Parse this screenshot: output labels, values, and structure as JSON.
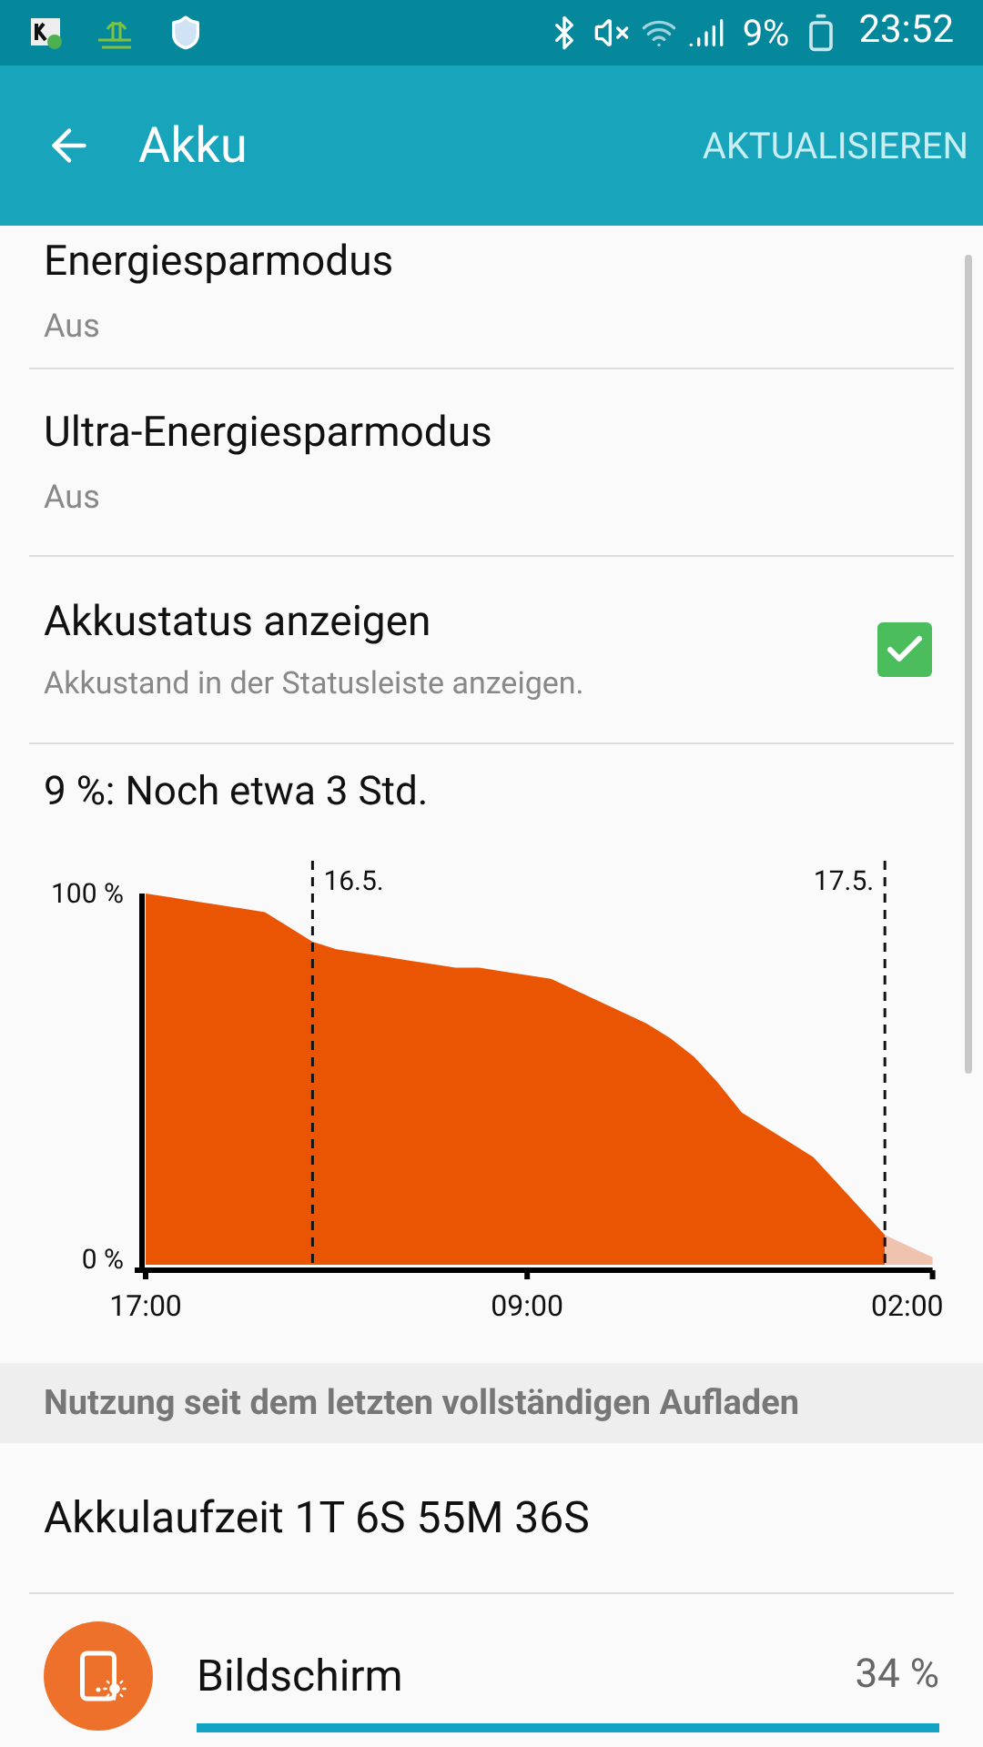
{
  "status_bar": {
    "battery_text": "9%",
    "time": "23:52"
  },
  "app_bar": {
    "title": "Akku",
    "action": "AKTUALISIEREN"
  },
  "settings": [
    {
      "kind": "text",
      "title": "Energiesparmodus",
      "subtitle": "Aus"
    },
    {
      "kind": "text",
      "title": "Ultra-Energiesparmodus",
      "subtitle": "Aus"
    },
    {
      "kind": "checkbox",
      "title": "Akkustatus anzeigen",
      "subtitle": "Akkustand in der Statusleiste anzeigen.",
      "checked": true
    }
  ],
  "estimate": "9 %: Noch etwa 3 Std.",
  "chart_data": {
    "type": "area",
    "categories": [
      "17:00",
      null,
      null,
      null,
      null,
      null,
      null,
      null,
      null,
      null,
      null,
      null,
      null,
      null,
      null,
      null,
      "09:00",
      null,
      null,
      null,
      null,
      null,
      null,
      null,
      null,
      null,
      null,
      null,
      null,
      null,
      null,
      null,
      null,
      "02:00"
    ],
    "series": [
      {
        "color": "#ea5504",
        "values": [
          100,
          99,
          98,
          97,
          96,
          95,
          91,
          87,
          85,
          84,
          83,
          82,
          81,
          80,
          80,
          79,
          78,
          77,
          74,
          71,
          68,
          65,
          61,
          56,
          49,
          41,
          37,
          33,
          29,
          22,
          15,
          8,
          null,
          null
        ]
      },
      {
        "color": "#f0c3ae",
        "values": [
          null,
          null,
          null,
          null,
          null,
          null,
          null,
          null,
          null,
          null,
          null,
          null,
          null,
          null,
          null,
          null,
          null,
          null,
          null,
          null,
          null,
          null,
          null,
          null,
          null,
          null,
          null,
          null,
          null,
          null,
          null,
          8,
          5,
          2
        ]
      }
    ],
    "ylim": [
      0,
      100
    ],
    "yticks": [
      {
        "value": 0,
        "label": "0 %"
      },
      {
        "value": 100,
        "label": "100 %"
      }
    ],
    "annotations": [
      "16.5.",
      "17.5."
    ]
  },
  "usage_header": "Nutzung seit dem letzten vollständigen Aufladen",
  "uptime": "Akkulaufzeit 1T 6S 55M 36S",
  "usage": [
    {
      "name": "Bildschirm",
      "percent": "34 %"
    }
  ]
}
